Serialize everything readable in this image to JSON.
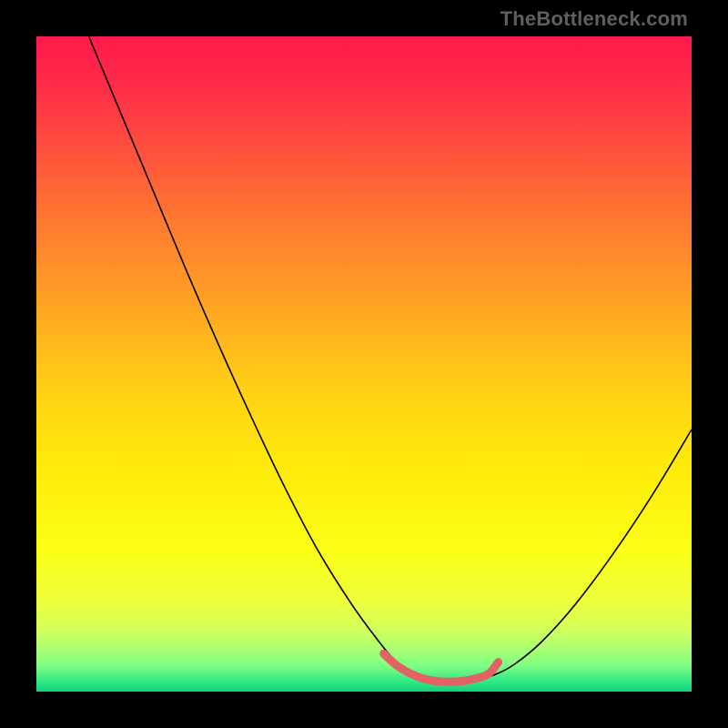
{
  "watermark": "TheBottleneck.com",
  "gradient": {
    "stops": [
      {
        "offset": 0.0,
        "color": "#ff1a4c"
      },
      {
        "offset": 0.07,
        "color": "#ff2a48"
      },
      {
        "offset": 0.15,
        "color": "#ff4640"
      },
      {
        "offset": 0.25,
        "color": "#ff6e33"
      },
      {
        "offset": 0.35,
        "color": "#ff8f2a"
      },
      {
        "offset": 0.45,
        "color": "#ffb21e"
      },
      {
        "offset": 0.55,
        "color": "#ffd313"
      },
      {
        "offset": 0.65,
        "color": "#ffe90a"
      },
      {
        "offset": 0.78,
        "color": "#fcff14"
      },
      {
        "offset": 0.86,
        "color": "#eeff3c"
      },
      {
        "offset": 0.9,
        "color": "#d6ff57"
      },
      {
        "offset": 0.93,
        "color": "#b3ff6f"
      },
      {
        "offset": 0.96,
        "color": "#7fff82"
      },
      {
        "offset": 0.985,
        "color": "#30e886"
      },
      {
        "offset": 1.0,
        "color": "#12d07a"
      }
    ]
  },
  "chart_data": {
    "type": "line",
    "title": "",
    "xlabel": "",
    "ylabel": "",
    "xlim": [
      0,
      100
    ],
    "ylim": [
      0,
      100
    ],
    "series": [
      {
        "name": "bottleneck-curve",
        "color": "#000000",
        "width": 1.6,
        "points": [
          {
            "x": 8.0,
            "y": 100.0
          },
          {
            "x": 13.0,
            "y": 88.0
          },
          {
            "x": 18.0,
            "y": 76.0
          },
          {
            "x": 23.0,
            "y": 64.0
          },
          {
            "x": 28.0,
            "y": 52.5
          },
          {
            "x": 33.0,
            "y": 41.5
          },
          {
            "x": 38.0,
            "y": 31.0
          },
          {
            "x": 43.0,
            "y": 21.5
          },
          {
            "x": 48.0,
            "y": 13.5
          },
          {
            "x": 52.0,
            "y": 8.0
          },
          {
            "x": 55.0,
            "y": 4.5
          },
          {
            "x": 58.0,
            "y": 2.3
          },
          {
            "x": 61.0,
            "y": 1.3
          },
          {
            "x": 64.0,
            "y": 1.2
          },
          {
            "x": 67.0,
            "y": 1.6
          },
          {
            "x": 70.0,
            "y": 2.6
          },
          {
            "x": 73.0,
            "y": 4.2
          },
          {
            "x": 77.0,
            "y": 7.5
          },
          {
            "x": 82.0,
            "y": 13.0
          },
          {
            "x": 88.0,
            "y": 21.0
          },
          {
            "x": 94.0,
            "y": 30.0
          },
          {
            "x": 100.0,
            "y": 40.0
          }
        ]
      },
      {
        "name": "optimal-band",
        "color": "#e16363",
        "width": 9,
        "cap": "round",
        "points": [
          {
            "x": 53.0,
            "y": 5.8
          },
          {
            "x": 55.0,
            "y": 4.0
          },
          {
            "x": 57.0,
            "y": 2.8
          },
          {
            "x": 59.0,
            "y": 2.0
          },
          {
            "x": 61.0,
            "y": 1.6
          },
          {
            "x": 63.0,
            "y": 1.5
          },
          {
            "x": 65.0,
            "y": 1.6
          },
          {
            "x": 67.0,
            "y": 2.0
          },
          {
            "x": 69.0,
            "y": 2.7
          },
          {
            "x": 70.5,
            "y": 4.5
          }
        ]
      }
    ]
  }
}
